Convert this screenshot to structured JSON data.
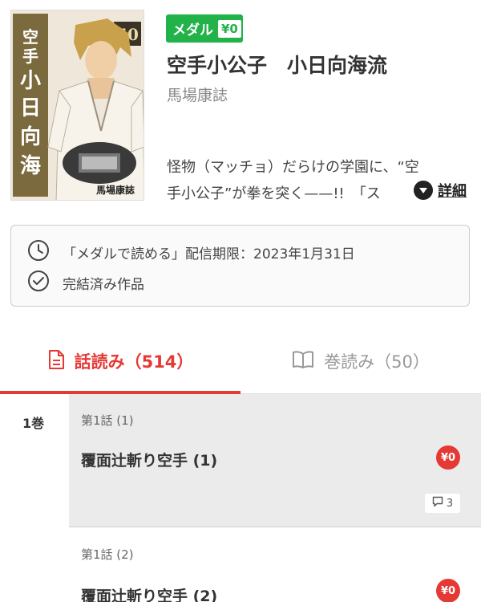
{
  "header": {
    "cover_alt": "",
    "medal_label": "メダル",
    "medal_price": "¥0",
    "title": "空手小公子　小日向海流",
    "author": "馬場康誌",
    "description_line1": "怪物（マッチョ）だらけの学園に、“空",
    "description_line2": "手小公子”が拳を突く——!!　「ス",
    "more_label": "詳細"
  },
  "info": {
    "deadline_text": "「メダルで読める」配信期限：2023年1月31日",
    "completed_text": "完結済み作品"
  },
  "tabs": [
    {
      "label": "話読み（514）",
      "active": true,
      "icon": "document-icon"
    },
    {
      "label": "巻読み（50）",
      "active": false,
      "icon": "book-icon"
    }
  ],
  "volume_label": "1巻",
  "episodes": [
    {
      "number": "第1話 (1)",
      "title": "覆面辻斬り空手 (1)",
      "price": "¥0",
      "comments": "3"
    },
    {
      "number": "第1話 (2)",
      "title": "覆面辻斬り空手 (2)",
      "price": "¥0"
    }
  ],
  "colors": {
    "accent_red": "#e53935",
    "medal_green": "#21b24a",
    "read_bg": "#ebebeb"
  }
}
